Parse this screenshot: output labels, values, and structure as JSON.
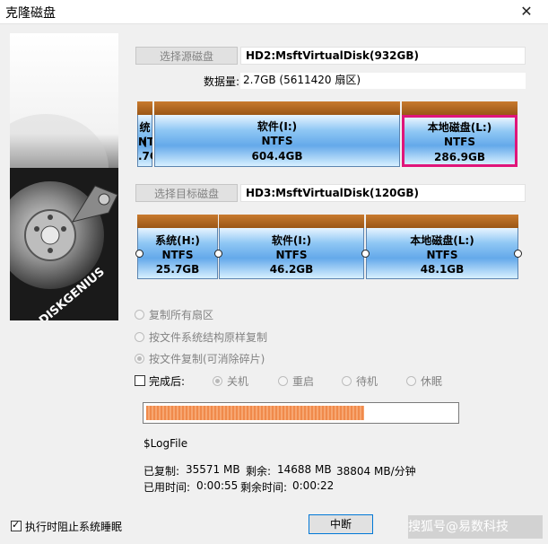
{
  "window": {
    "title": "克隆磁盘",
    "close_glyph": "✕"
  },
  "side_image": {
    "brand_text": "DISKGENIUS"
  },
  "source": {
    "button_label": "选择源磁盘",
    "disk_name": "HD2:MsftVirtualDisk(932GB)",
    "data_amount_label": "数据量:",
    "data_amount_value": "2.7GB (5611420 扇区)",
    "partitions": [
      {
        "name": "统(",
        "fs": "NTF",
        "size": ".7C"
      },
      {
        "name": "软件(I:)",
        "fs": "NTFS",
        "size": "604.4GB"
      },
      {
        "name": "本地磁盘(L:)",
        "fs": "NTFS",
        "size": "286.9GB"
      }
    ]
  },
  "target": {
    "button_label": "选择目标磁盘",
    "disk_name": "HD3:MsftVirtualDisk(120GB)",
    "partitions": [
      {
        "name": "系统(H:)",
        "fs": "NTFS",
        "size": "25.7GB"
      },
      {
        "name": "软件(I:)",
        "fs": "NTFS",
        "size": "46.2GB"
      },
      {
        "name": "本地磁盘(L:)",
        "fs": "NTFS",
        "size": "48.1GB"
      }
    ]
  },
  "copy_modes": [
    {
      "label": "复制所有扇区",
      "checked": false
    },
    {
      "label": "按文件系统结构原样复制",
      "checked": false
    },
    {
      "label": "按文件复制(可消除碎片)",
      "checked": true
    }
  ],
  "after_completion": {
    "label": "完成后:",
    "checked": false,
    "options": [
      {
        "label": "关机",
        "checked": true
      },
      {
        "label": "重启",
        "checked": false
      },
      {
        "label": "待机",
        "checked": false
      },
      {
        "label": "休眠",
        "checked": false
      }
    ]
  },
  "progress": {
    "fraction": 0.705
  },
  "current_file": "$LogFile",
  "stats": {
    "copied_label": "已复制:",
    "copied_value": "35571 MB",
    "remaining_label": "剩余:",
    "remaining_value": "14688 MB",
    "speed": "38804 MB/分钟",
    "elapsed_label": "已用时间:",
    "elapsed_value": "0:00:55",
    "remaining_time_label": "剩余时间:",
    "remaining_time_value": "0:00:22"
  },
  "prevent_sleep": {
    "label": "执行时阻止系统睡眠",
    "checked": true
  },
  "interrupt_button": "中断",
  "watermark": "搜狐号@易数科技",
  "colors": {
    "selected_partition_border": "#e0157a",
    "progress_fill": "#f08a4b"
  }
}
